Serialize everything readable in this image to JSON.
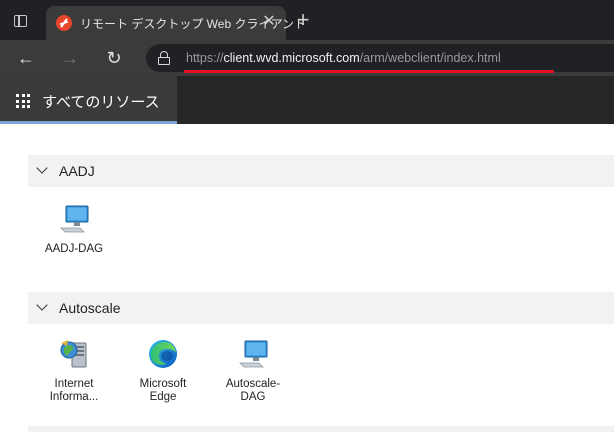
{
  "browser": {
    "tab": {
      "title": "リモート デスクトップ Web クライアント"
    },
    "close_glyph": "✕",
    "new_tab_glyph": "+",
    "back_glyph": "←",
    "forward_glyph": "→",
    "refresh_glyph": "↻",
    "url": {
      "scheme": "https://",
      "host": "client.wvd.microsoft.com",
      "path": "/arm/webclient/index.html"
    },
    "highlight_color": "#e81123"
  },
  "app": {
    "tab_label": "すべてのリソース",
    "accent": "#7aa7d6"
  },
  "groups": [
    {
      "name": "AADJ",
      "resources": [
        {
          "label": "AADJ-DAG",
          "icon": "desktop-icon"
        }
      ]
    },
    {
      "name": "Autoscale",
      "resources": [
        {
          "label": "Internet Informa...",
          "icon": "iis-manager-icon"
        },
        {
          "label": "Microsoft Edge",
          "icon": "edge-icon"
        },
        {
          "label": "Autoscale-DAG",
          "icon": "desktop-icon"
        }
      ]
    }
  ]
}
